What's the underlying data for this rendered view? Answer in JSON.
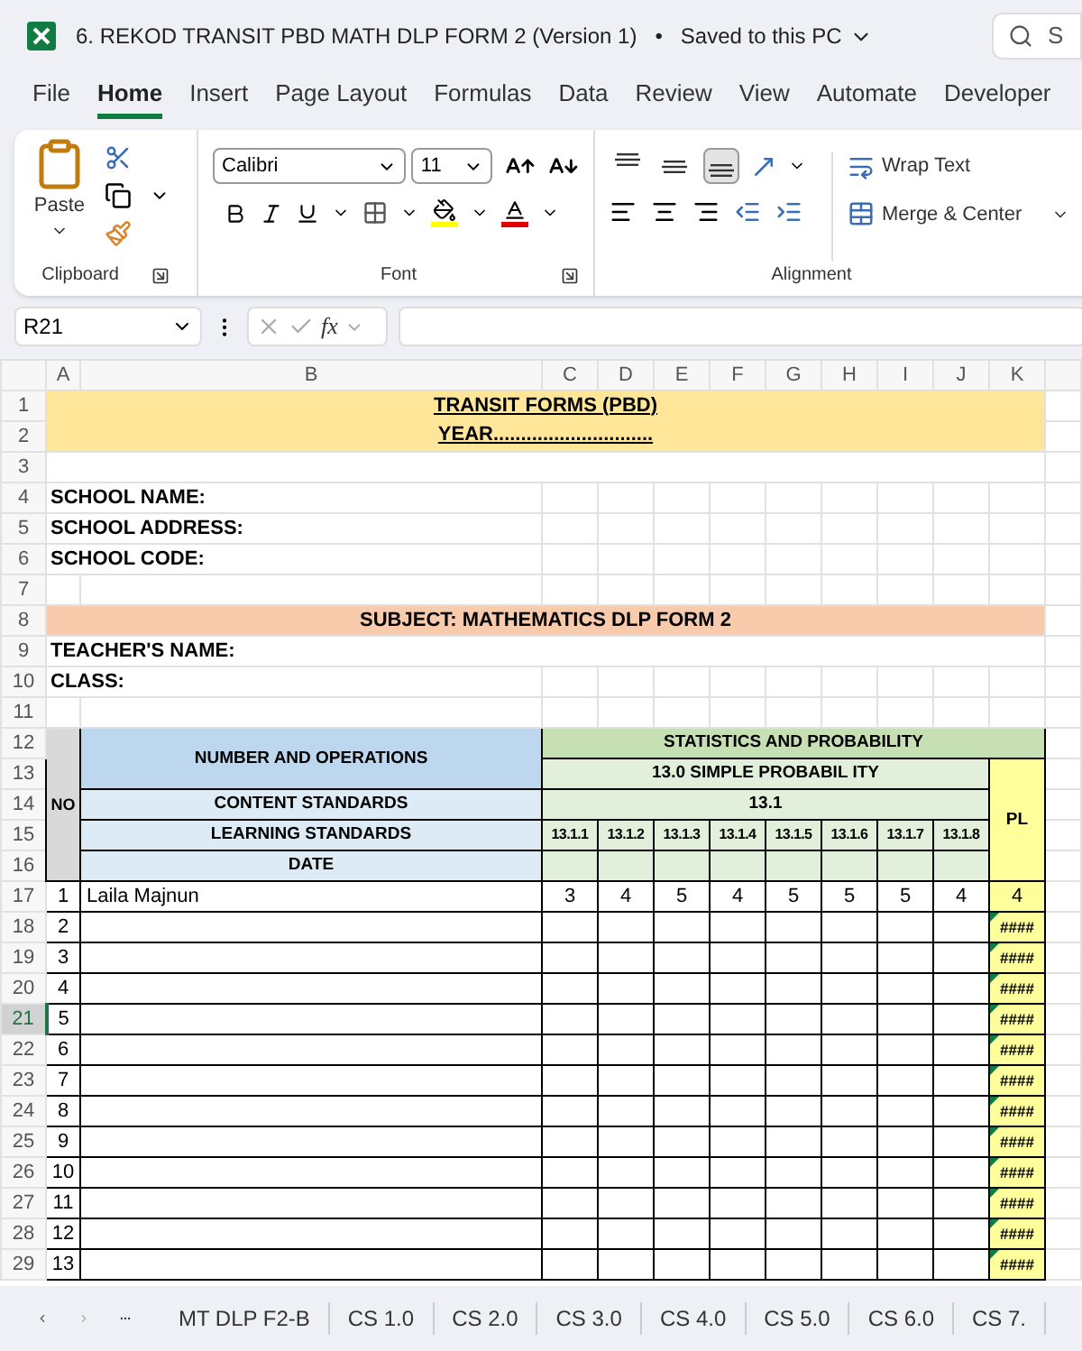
{
  "window": {
    "title": "6. REKOD TRANSIT PBD MATH DLP FORM 2 (Version 1)",
    "separator": "•",
    "save_status": "Saved to this PC",
    "search": {
      "placeholder": "S"
    }
  },
  "menu_tabs": [
    {
      "label": "File",
      "selected": false
    },
    {
      "label": "Home",
      "selected": true
    },
    {
      "label": "Insert",
      "selected": false
    },
    {
      "label": "Page Layout",
      "selected": false
    },
    {
      "label": "Formulas",
      "selected": false
    },
    {
      "label": "Data",
      "selected": false
    },
    {
      "label": "Review",
      "selected": false
    },
    {
      "label": "View",
      "selected": false
    },
    {
      "label": "Automate",
      "selected": false
    },
    {
      "label": "Developer",
      "selected": false
    }
  ],
  "ribbon": {
    "clipboard": {
      "label": "Clipboard",
      "paste_label": "Paste"
    },
    "font": {
      "label": "Font",
      "font_name": "Calibri",
      "font_size": "11"
    },
    "alignment": {
      "label": "Alignment",
      "vertical_align": [
        {
          "selected": false
        },
        {
          "selected": false
        },
        {
          "selected": true
        }
      ],
      "wrap_text": "Wrap Text",
      "merge": "Merge & Center"
    }
  },
  "formula_bar": {
    "name_box": "R21",
    "fx": "fx"
  },
  "sheet": {
    "columns": [
      "A",
      "B",
      "C",
      "D",
      "E",
      "F",
      "G",
      "H",
      "I",
      "J",
      "K"
    ],
    "row_numbers": [
      {
        "label": "1",
        "selected": false
      },
      {
        "label": "2",
        "selected": false
      },
      {
        "label": "3",
        "selected": false
      },
      {
        "label": "4",
        "selected": false
      },
      {
        "label": "5",
        "selected": false
      },
      {
        "label": "6",
        "selected": false
      },
      {
        "label": "7",
        "selected": false
      },
      {
        "label": "8",
        "selected": false
      },
      {
        "label": "9",
        "selected": false
      },
      {
        "label": "10",
        "selected": false
      },
      {
        "label": "11",
        "selected": false
      },
      {
        "label": "12",
        "selected": false
      },
      {
        "label": "13",
        "selected": false
      },
      {
        "label": "14",
        "selected": false
      },
      {
        "label": "15",
        "selected": false
      },
      {
        "label": "16",
        "selected": false
      },
      {
        "label": "17",
        "selected": false
      },
      {
        "label": "18",
        "selected": false
      },
      {
        "label": "19",
        "selected": false
      },
      {
        "label": "20",
        "selected": false
      },
      {
        "label": "21",
        "selected": true
      },
      {
        "label": "22",
        "selected": false
      },
      {
        "label": "23",
        "selected": false
      },
      {
        "label": "24",
        "selected": false
      },
      {
        "label": "25",
        "selected": false
      },
      {
        "label": "26",
        "selected": false
      },
      {
        "label": "27",
        "selected": false
      },
      {
        "label": "28",
        "selected": false
      },
      {
        "label": "29",
        "selected": false
      }
    ],
    "title": "TRANSIT FORMS (PBD)",
    "year": "YEAR.............................",
    "school_fields": [
      "SCHOOL NAME:",
      "SCHOOL ADDRESS:",
      "SCHOOL CODE:"
    ],
    "subject": "SUBJECT: MATHEMATICS DLP FORM 2",
    "teacher_name": "TEACHER'S NAME:",
    "class_label": "CLASS:",
    "table": {
      "no_header": "NO",
      "area": "NUMBER AND OPERATIONS",
      "content_label": "CONTENT STANDARDS",
      "learning_label": "LEARNING STANDARDS",
      "date_label": "DATE",
      "strand": "STATISTICS AND PROBABILITY",
      "topic": "13.0 SIMPLE PROBABIL ITY",
      "content_standard": "13.1",
      "pl_header": "PL",
      "learning_standards": [
        "13.1.1",
        "13.1.2",
        "13.1.3",
        "13.1.4",
        "13.1.5",
        "13.1.6",
        "13.1.7",
        "13.1.8"
      ],
      "students": [
        {
          "no": "1",
          "name": "Laila Majnun",
          "scores": [
            "3",
            "4",
            "5",
            "4",
            "5",
            "5",
            "5",
            "4"
          ],
          "pl": "4",
          "error": false
        },
        {
          "no": "2",
          "pl": "####",
          "error": true
        },
        {
          "no": "3",
          "pl": "####",
          "error": true
        },
        {
          "no": "4",
          "pl": "####",
          "error": true
        },
        {
          "no": "5",
          "pl": "####",
          "error": true
        },
        {
          "no": "6",
          "pl": "####",
          "error": true
        },
        {
          "no": "7",
          "pl": "####",
          "error": true
        },
        {
          "no": "8",
          "pl": "####",
          "error": true
        },
        {
          "no": "9",
          "pl": "####",
          "error": true
        },
        {
          "no": "10",
          "pl": "####",
          "error": true
        },
        {
          "no": "11",
          "pl": "####",
          "error": true
        },
        {
          "no": "12",
          "pl": "####",
          "error": true
        },
        {
          "no": "13",
          "pl": "####",
          "error": true
        }
      ]
    }
  },
  "sheet_tabs": [
    {
      "label": "MT DLP F2-B",
      "selected": false
    },
    {
      "label": "CS 1.0",
      "selected": false
    },
    {
      "label": "CS 2.0",
      "selected": false
    },
    {
      "label": "CS 3.0",
      "selected": false
    },
    {
      "label": "CS 4.0",
      "selected": false
    },
    {
      "label": "CS 5.0",
      "selected": false
    },
    {
      "label": "CS 6.0",
      "selected": false
    },
    {
      "label": "CS 7.",
      "selected": false
    }
  ]
}
